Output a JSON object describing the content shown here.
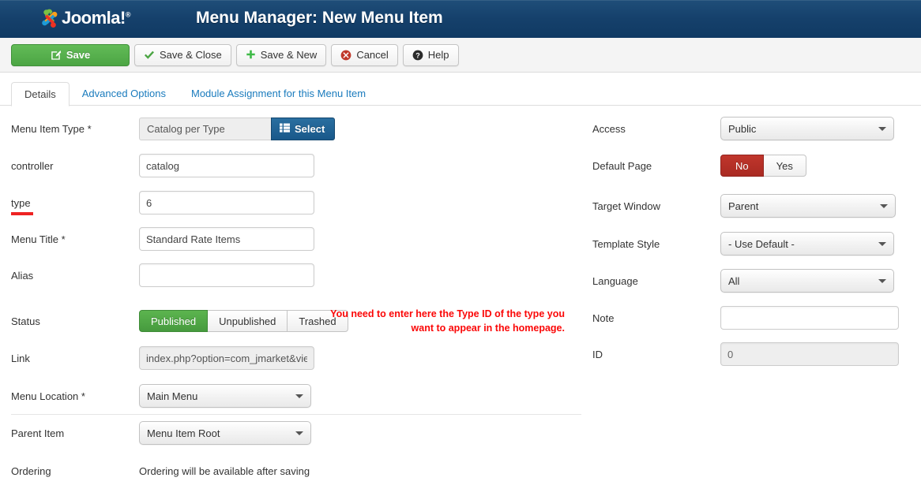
{
  "header": {
    "brand": "Joomla!",
    "brand_sup": "®",
    "title": "Menu Manager: New Menu Item",
    "logo_icon": "joomla-logo-icon"
  },
  "toolbar": {
    "buttons": [
      {
        "label": "Save",
        "icon": "edit-square-icon",
        "style": "primary"
      },
      {
        "label": "Save & Close",
        "icon": "check-icon",
        "style": "default"
      },
      {
        "label": "Save & New",
        "icon": "plus-icon",
        "style": "default"
      },
      {
        "label": "Cancel",
        "icon": "cancel-circle-icon",
        "style": "default"
      },
      {
        "label": "Help",
        "icon": "question-circle-icon",
        "style": "default"
      }
    ]
  },
  "tabs": [
    {
      "label": "Details",
      "active": true
    },
    {
      "label": "Advanced Options",
      "active": false
    },
    {
      "label": "Module Assignment for this Menu Item",
      "active": false
    }
  ],
  "left_column": {
    "menu_item_type": {
      "label": "Menu Item Type *",
      "value": "Catalog per Type",
      "select_button_label": "Select",
      "select_button_icon": "list-grid-icon"
    },
    "controller": {
      "label": "controller",
      "value": "catalog",
      "placeholder": ""
    },
    "type": {
      "label": "type",
      "value": "6",
      "placeholder": ""
    },
    "menu_title": {
      "label": "Menu Title *",
      "value": "Standard Rate Items",
      "placeholder": ""
    },
    "alias": {
      "label": "Alias",
      "value": "",
      "placeholder": ""
    },
    "status": {
      "label": "Status",
      "options": [
        "Published",
        "Unpublished",
        "Trashed"
      ],
      "selected": "Published"
    },
    "link": {
      "label": "Link",
      "value": "index.php?option=com_jmarket&vie",
      "readonly": true
    },
    "menu_location": {
      "label": "Menu Location *",
      "value": "Main Menu"
    },
    "parent_item": {
      "label": "Parent Item",
      "value": "Menu Item Root"
    },
    "ordering": {
      "label": "Ordering",
      "value": "Ordering will be available after saving"
    }
  },
  "right_column": {
    "access": {
      "label": "Access",
      "value": "Public"
    },
    "default_page": {
      "label": "Default Page",
      "options": [
        "No",
        "Yes"
      ],
      "selected": "No"
    },
    "target_window": {
      "label": "Target Window",
      "value": "Parent"
    },
    "template_style": {
      "label": "Template Style",
      "value": "- Use Default -"
    },
    "language": {
      "label": "Language",
      "value": "All"
    },
    "note": {
      "label": "Note",
      "value": "",
      "placeholder": ""
    },
    "id": {
      "label": "ID",
      "value": "0",
      "disabled": true
    }
  },
  "annotation": {
    "line1": "You need to enter here the Type ID of the type",
    "line2": "you want to appear in the homepage."
  },
  "colors": {
    "header_blue": "#15406b",
    "primary_green": "#4ca544",
    "select_blue": "#19588a",
    "danger_red": "#a92a22",
    "annotation_red": "#fb0707",
    "link_blue": "#1a7bbd"
  }
}
